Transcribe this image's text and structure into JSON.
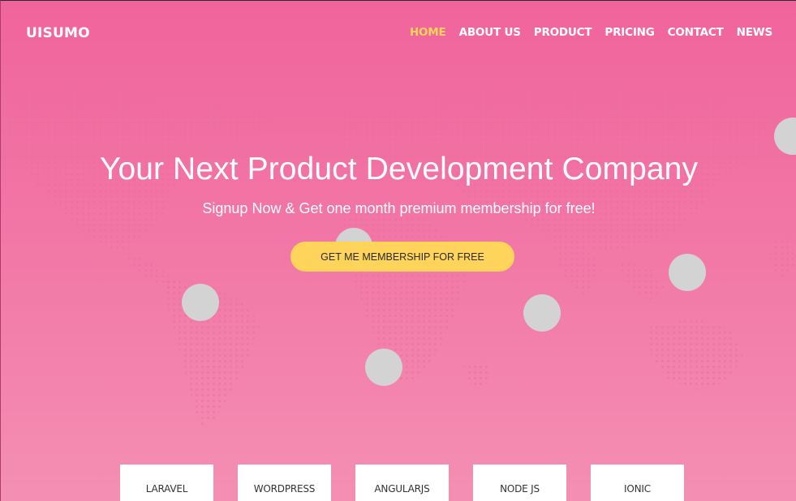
{
  "brand": {
    "name": "UISUMO"
  },
  "nav": {
    "items": [
      {
        "label": "HOME",
        "active": true
      },
      {
        "label": "ABOUT US",
        "active": false
      },
      {
        "label": "PRODUCT",
        "active": false
      },
      {
        "label": "PRICING",
        "active": false
      },
      {
        "label": "CONTACT",
        "active": false
      },
      {
        "label": "NEWS",
        "active": false
      }
    ]
  },
  "hero": {
    "title": "Your Next Product Development Company",
    "subtitle": "Signup Now & Get one month premium membership for free!",
    "cta_label": "GET ME MEMBERSHIP FOR FREE"
  },
  "technologies": [
    {
      "label": "LARAVEL"
    },
    {
      "label": "WORDPRESS"
    },
    {
      "label": "ANGULARJS"
    },
    {
      "label": "NODE JS"
    },
    {
      "label": "IONIC"
    }
  ],
  "colors": {
    "background": "#f0649c",
    "accent": "#ffd45a",
    "bubble": "#d3d3d3",
    "text": "#ffffff"
  }
}
